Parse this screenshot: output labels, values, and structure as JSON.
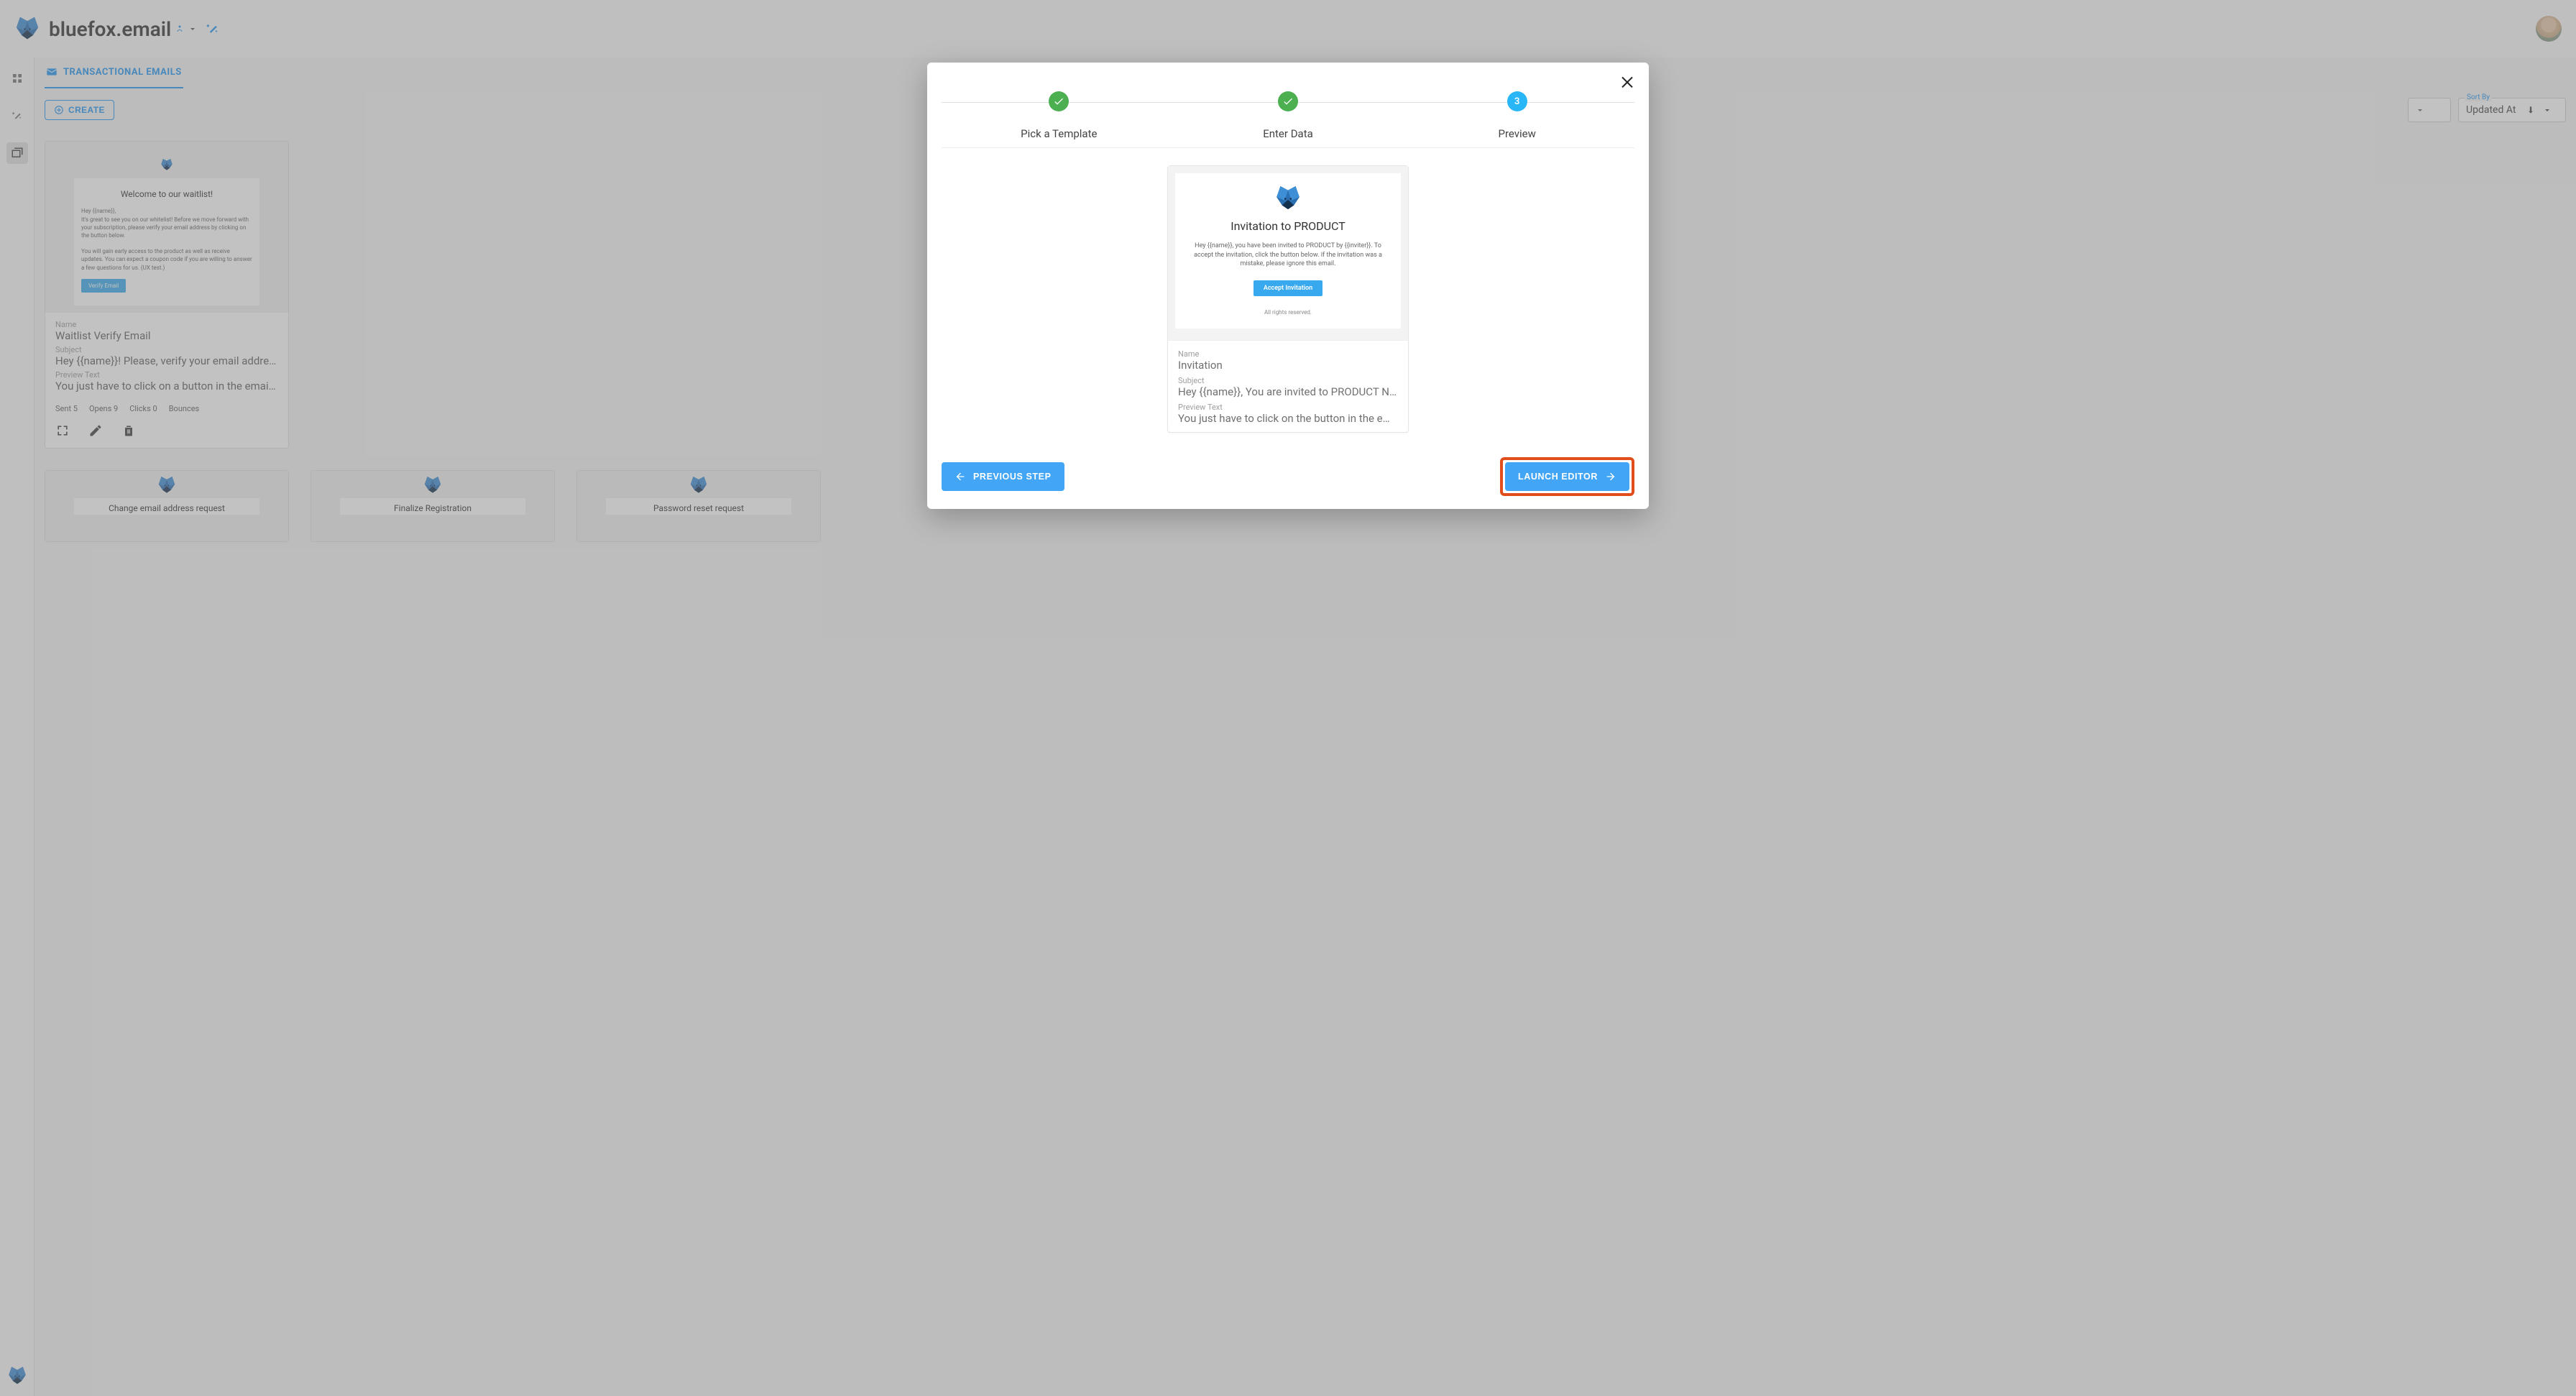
{
  "header": {
    "brand": "bluefox.email"
  },
  "tabs": {
    "transactional": "TRANSACTIONAL EMAILS"
  },
  "toolbar": {
    "create": "CREATE",
    "sort_label": "Sort By",
    "sort_value": "Updated At"
  },
  "cards": [
    {
      "preview_title": "Welcome to our waitlist!",
      "preview_line1": "Hey {{name}},",
      "preview_line2": "It's great to see you on our whitelist! Before we move forward with your subscription, please verify your email address by clicking on the button below.",
      "preview_line3": "You will gain early access to the product as well as receive updates. You can expect a coupon code if you are willing to answer a few questions for us. (UX test.)",
      "preview_btn": "Verify Email",
      "name_label": "Name",
      "name": "Waitlist Verify Email",
      "subject_label": "Subject",
      "subject": "Hey {{name}}! Please, verify your email address",
      "preview_text_label": "Preview Text",
      "preview_text": "You just have to click on a button in the email to verify.",
      "stats": {
        "sent_label": "Sent",
        "sent": "5",
        "opens_label": "Opens",
        "opens": "9",
        "clicks_label": "Clicks",
        "clicks": "0",
        "bounces_label": "Bounces"
      }
    }
  ],
  "small_cards": [
    {
      "title": "Change email address request"
    },
    {
      "title": "Finalize Registration"
    },
    {
      "title": "Password reset request"
    }
  ],
  "modal": {
    "steps": {
      "pick": "Pick a Template",
      "enter": "Enter Data",
      "preview": "Preview",
      "num": "3"
    },
    "preview": {
      "title": "Invitation to PRODUCT",
      "body": "Hey {{name}}, you have been invited to PRODUCT by {{inviter}}. To accept the invitation, click the button below. If the invitation was a mistake, please ignore this email.",
      "button": "Accept Invitation",
      "rights": "All rights reserved."
    },
    "meta": {
      "name_label": "Name",
      "name": "Invitation",
      "subject_label": "Subject",
      "subject": "Hey {{name}}, You are invited to PRODUCT NAME",
      "preview_text_label": "Preview Text",
      "preview_text": "You just have to click on the button in the email to accept."
    },
    "actions": {
      "prev": "PREVIOUS STEP",
      "launch": "LAUNCH EDITOR"
    }
  }
}
